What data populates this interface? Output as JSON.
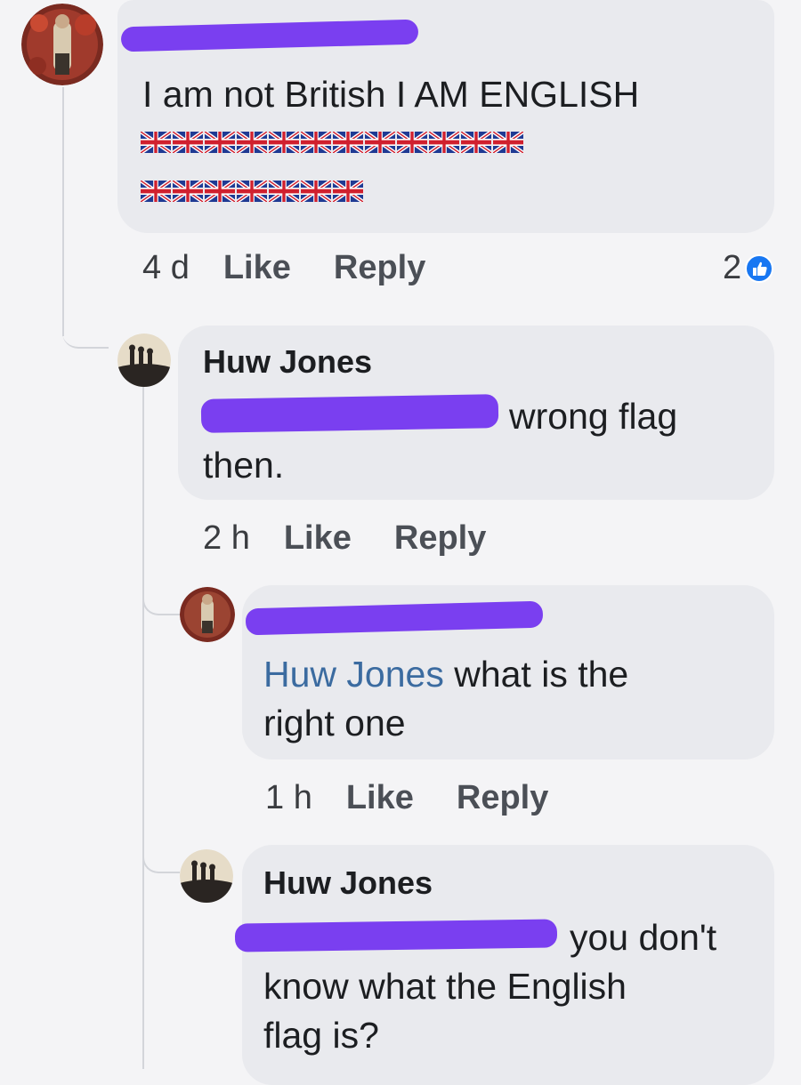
{
  "comments": [
    {
      "author": "",
      "text": "I am not British I AM ENGLISH",
      "flag_rows": [
        12,
        7
      ],
      "time": "4 d",
      "like_label": "Like",
      "reply_label": "Reply",
      "reaction_count": "2"
    },
    {
      "author": "Huw Jones",
      "text_line1": "wrong flag",
      "text_line2": "then.",
      "time": "2 h",
      "like_label": "Like",
      "reply_label": "Reply"
    },
    {
      "author": "",
      "mention": "Huw Jones",
      "text_line1": " what is the",
      "text_line2": "right one",
      "time": "1 h",
      "like_label": "Like",
      "reply_label": "Reply"
    },
    {
      "author": "Huw Jones",
      "text_line1": "you don't",
      "text_line2": "know what the English",
      "text_line3": "flag is?"
    }
  ],
  "icons": {
    "flag": "union-jack-flag-icon",
    "reaction": "like-icon"
  },
  "colors": {
    "redaction": "#7a3ff0",
    "bubble": "#e9eaee",
    "mention": "#3b6ba0",
    "like_blue": "#1877f2"
  }
}
